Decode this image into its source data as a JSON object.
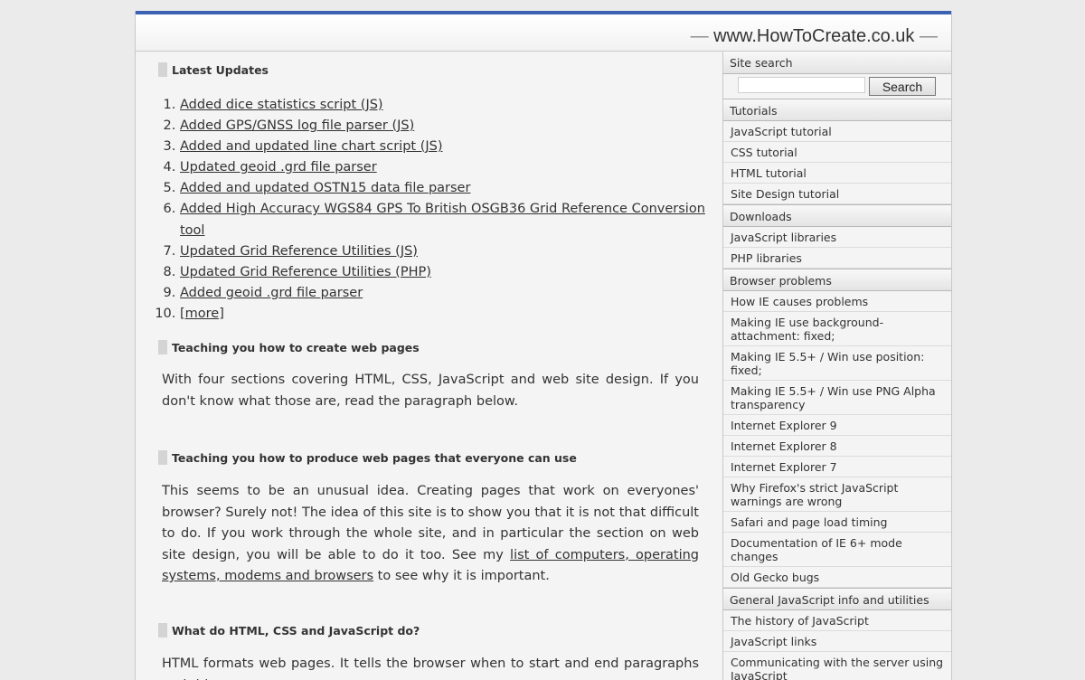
{
  "site": {
    "title": "www.HowToCreate.co.uk",
    "dash": "—"
  },
  "main": {
    "latest_updates": {
      "heading": "Latest Updates",
      "items": [
        "Added dice statistics script (JS)",
        "Added GPS/GNSS log file parser (JS)",
        "Added and updated line chart script (JS)",
        "Updated geoid .grd file parser",
        "Added and updated OSTN15 data file parser",
        "Added High Accuracy WGS84 GPS To British OSGB36 Grid Reference Conversion tool",
        "Updated Grid Reference Utilities (JS)",
        "Updated Grid Reference Utilities (PHP)",
        "Added geoid .grd file parser",
        "[more]"
      ]
    },
    "teaching": {
      "heading": "Teaching you how to create web pages",
      "text": "With four sections covering HTML, CSS, JavaScript and web site design. If you don't know what those are, read the paragraph below."
    },
    "everyone": {
      "heading": "Teaching you how to produce web pages that everyone can use",
      "text_before": "This seems to be an unusual idea. Creating pages that work on everyones' browser? Surely not! The idea of this site is to show you that it is not that difficult to do. If you work through the whole site, and in particular the section on web site design, you will be able to do it too. See my ",
      "link": "list of computers, operating systems, modems and browsers",
      "text_after": " to see why it is important."
    },
    "what_do": {
      "heading": "What do HTML, CSS and JavaScript do?",
      "text": "HTML formats web pages. It tells the browser when to start and end paragraphs and titles,"
    }
  },
  "sidebar": {
    "search": {
      "heading": "Site search",
      "placeholder": "",
      "button": "Search"
    },
    "tutorials": {
      "heading": "Tutorials",
      "items": [
        "JavaScript tutorial",
        "CSS tutorial",
        "HTML tutorial",
        "Site Design tutorial"
      ]
    },
    "downloads": {
      "heading": "Downloads",
      "items": [
        "JavaScript libraries",
        "PHP libraries"
      ]
    },
    "browser_problems": {
      "heading": "Browser problems",
      "items": [
        "How IE causes problems",
        "Making IE use background-attachment: fixed;",
        "Making IE 5.5+ / Win use position: fixed;",
        "Making IE 5.5+ / Win use PNG Alpha transparency",
        "Internet Explorer 9",
        "Internet Explorer 8",
        "Internet Explorer 7",
        "Why Firefox's strict JavaScript warnings are wrong",
        "Safari and page load timing",
        "Documentation of IE 6+ mode changes",
        "Old Gecko bugs"
      ]
    },
    "general_js": {
      "heading": "General JavaScript info and utilities",
      "items": [
        "The history of JavaScript",
        "JavaScript links",
        "Communicating with the server using JavaScript"
      ]
    }
  }
}
